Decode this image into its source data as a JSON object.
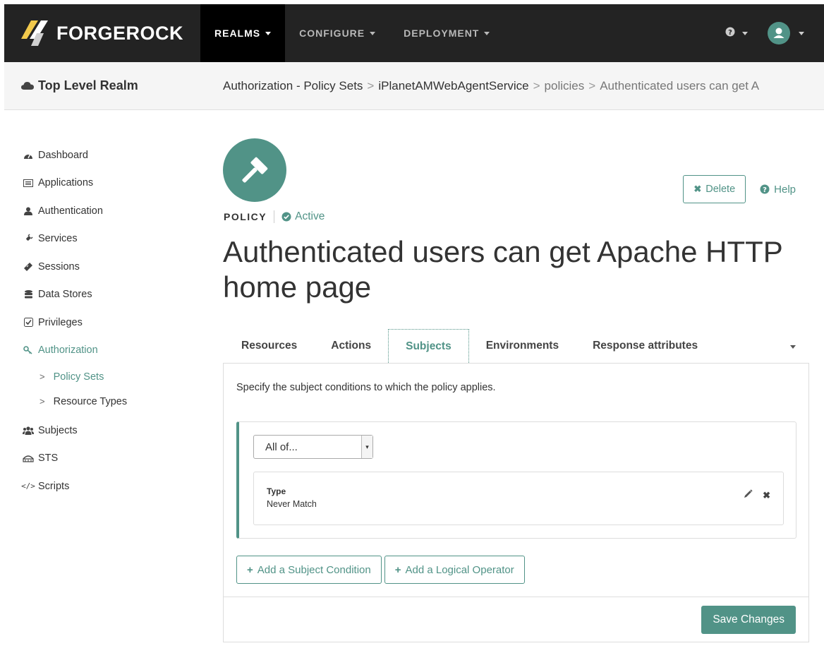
{
  "topnav": {
    "brand_name": "FORGEROCK",
    "items": [
      {
        "label": "REALMS",
        "active": true
      },
      {
        "label": "CONFIGURE",
        "active": false
      },
      {
        "label": "DEPLOYMENT",
        "active": false
      }
    ],
    "help_icon": "question-circle-icon",
    "user_icon": "user-avatar-icon"
  },
  "realmbar": {
    "realm_name": "Top Level Realm",
    "breadcrumbs": [
      "Authorization - Policy Sets",
      "iPlanetAMWebAgentService",
      "policies",
      "Authenticated users can get A"
    ]
  },
  "sidebar": {
    "items": [
      {
        "label": "Dashboard",
        "icon": "tachometer-icon"
      },
      {
        "label": "Applications",
        "icon": "list-alt-icon"
      },
      {
        "label": "Authentication",
        "icon": "user-icon"
      },
      {
        "label": "Services",
        "icon": "plug-icon"
      },
      {
        "label": "Sessions",
        "icon": "ticket-icon"
      },
      {
        "label": "Data Stores",
        "icon": "database-icon"
      },
      {
        "label": "Privileges",
        "icon": "check-square-icon"
      },
      {
        "label": "Authorization",
        "icon": "key-icon",
        "active": true
      }
    ],
    "subitems": [
      {
        "label": "Policy Sets",
        "active": true
      },
      {
        "label": "Resource Types",
        "active": false
      }
    ],
    "items_after": [
      {
        "label": "Subjects",
        "icon": "users-icon"
      },
      {
        "label": "STS",
        "icon": "sts-icon"
      },
      {
        "label": "Scripts",
        "icon": "code-icon"
      }
    ]
  },
  "policy": {
    "kicker": "POLICY",
    "status": "Active",
    "title": "Authenticated users can get Apache HTTP home page",
    "delete_label": "Delete",
    "help_label": "Help"
  },
  "tabs": [
    {
      "label": "Resources",
      "active": false
    },
    {
      "label": "Actions",
      "active": false
    },
    {
      "label": "Subjects",
      "active": true
    },
    {
      "label": "Environments",
      "active": false
    },
    {
      "label": "Response attributes",
      "active": false
    }
  ],
  "panel": {
    "description": "Specify the subject conditions to which the policy applies.",
    "operator_selected": "All of...",
    "condition": {
      "type_label": "Type",
      "type_value": "Never Match"
    },
    "add_subject_label": "Add a Subject Condition",
    "add_operator_label": "Add a Logical Operator",
    "save_label": "Save Changes"
  },
  "colors": {
    "accent": "#519387",
    "nav_bg": "#232323",
    "nav_active_bg": "#000000"
  }
}
